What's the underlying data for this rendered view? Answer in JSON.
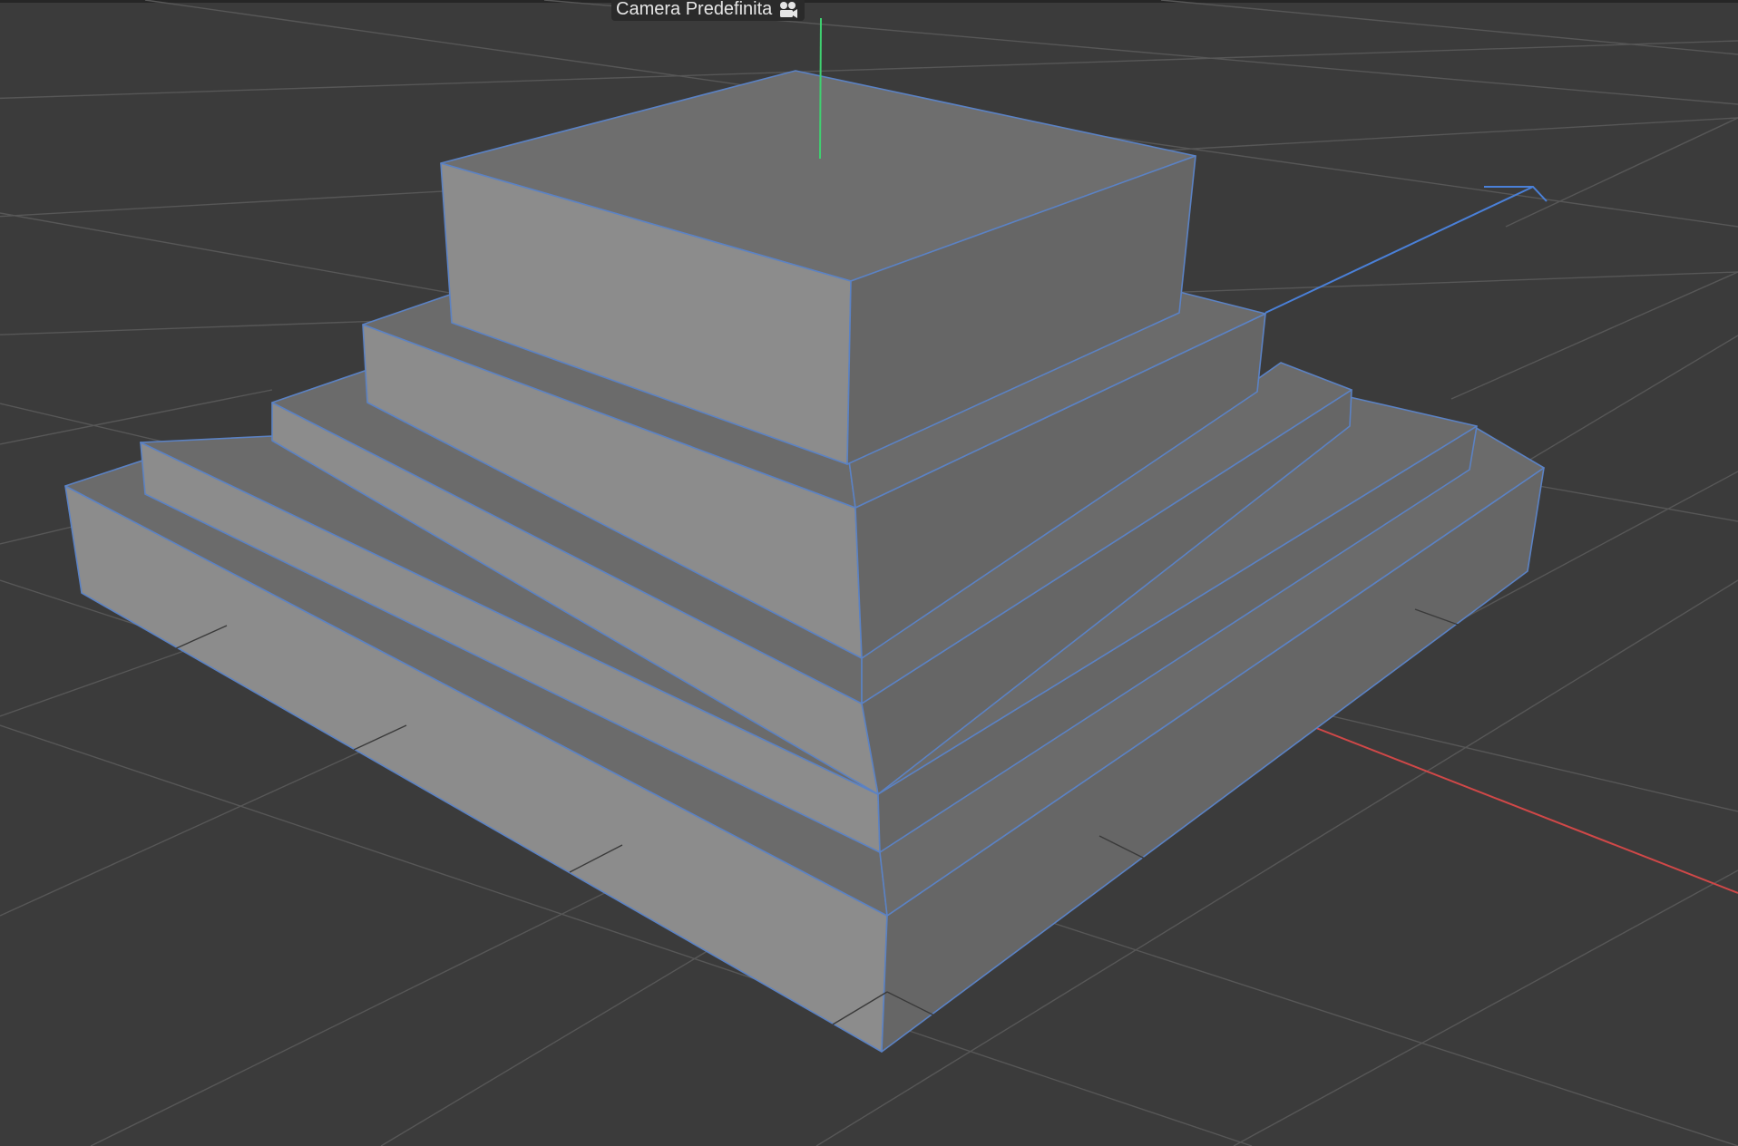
{
  "viewport": {
    "camera_label": "Camera Predefinita",
    "camera_icon": "camera-icon",
    "background_color": "#3b3b3b",
    "grid_color": "#5a5a5a",
    "wireframe_color": "#5b82c4",
    "axis_colors": {
      "x": "#d04848",
      "y": "#3fd070",
      "z": "#4a80d8"
    }
  }
}
